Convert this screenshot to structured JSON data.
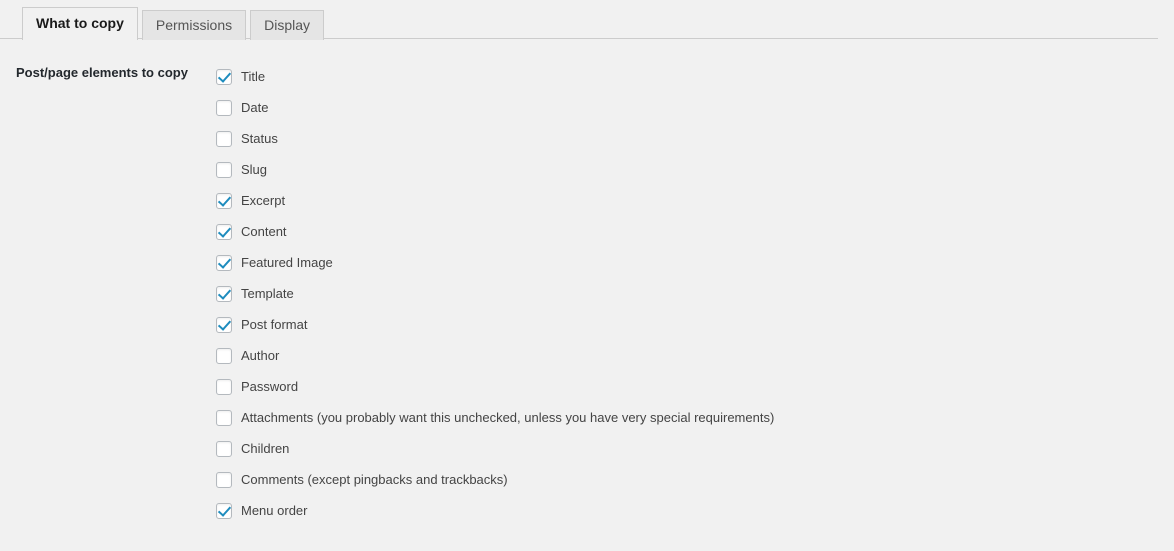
{
  "tabs": [
    {
      "label": "What to copy",
      "active": true
    },
    {
      "label": "Permissions",
      "active": false
    },
    {
      "label": "Display",
      "active": false
    }
  ],
  "form": {
    "field_label": "Post/page elements to copy",
    "options": [
      {
        "label": "Title",
        "checked": true
      },
      {
        "label": "Date",
        "checked": false
      },
      {
        "label": "Status",
        "checked": false
      },
      {
        "label": "Slug",
        "checked": false
      },
      {
        "label": "Excerpt",
        "checked": true
      },
      {
        "label": "Content",
        "checked": true
      },
      {
        "label": "Featured Image",
        "checked": true
      },
      {
        "label": "Template",
        "checked": true
      },
      {
        "label": "Post format",
        "checked": true
      },
      {
        "label": "Author",
        "checked": false
      },
      {
        "label": "Password",
        "checked": false
      },
      {
        "label": "Attachments (you probably want this unchecked, unless you have very special requirements)",
        "checked": false
      },
      {
        "label": "Children",
        "checked": false
      },
      {
        "label": "Comments (except pingbacks and trackbacks)",
        "checked": false
      },
      {
        "label": "Menu order",
        "checked": true
      }
    ]
  },
  "colors": {
    "page_background": "#f1f1f1",
    "tab_inactive_background": "#e5e5e5",
    "border": "#cccccc",
    "checkmark": "#1e8cbe",
    "checkbox_border": "#b4b9be",
    "label_text": "#444444",
    "heading_text": "#23282d"
  }
}
